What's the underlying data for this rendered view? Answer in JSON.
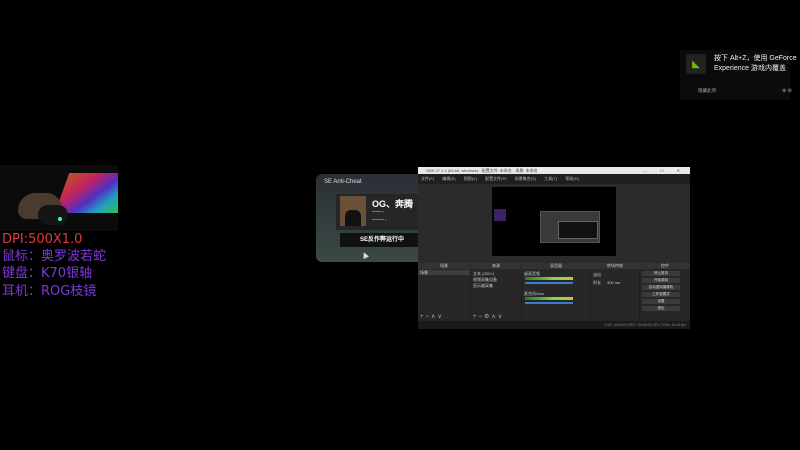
{
  "overlay": {
    "dpi": "DPI:500X1.0",
    "mouse": "鼠标：奥罗波若蛇",
    "keyboard": "键盘：K70银轴",
    "headset": "耳机：ROG枝镜"
  },
  "notification": {
    "line1": "按下 Alt+Z，使用 GeForce",
    "line2": "Experience 游戏内覆盖",
    "footer_left": "隐藏此项",
    "footer_right": "⊕ ⚙"
  },
  "se_window": {
    "title": "SE Anti-Cheat",
    "player_name": "OG、奔腾",
    "button": "SE反作弊运行中"
  },
  "obs": {
    "title": "OBS 27.1.3 (64-bit, windows) - 配置文件: 未命名 - 场景: 未命名",
    "menus": [
      "文件(F)",
      "编辑(E)",
      "视图(V)",
      "配置文件(P)",
      "场景集合(S)",
      "工具(T)",
      "帮助(H)"
    ],
    "docks": {
      "scenes": {
        "header": "场景",
        "items": [
          "场景"
        ]
      },
      "sources": {
        "header": "来源",
        "items": [
          "文本 (GDI+)",
          "视频采集设备",
          "显示器采集"
        ]
      },
      "mixer": {
        "header": "混音器",
        "channels": [
          "桌面音频",
          "麦克风/Aux"
        ]
      },
      "transitions": {
        "header": "转场特效",
        "type": "淡出",
        "duration_label": "时长",
        "duration": "300 ms"
      },
      "controls": {
        "header": "控件",
        "buttons": [
          "停止推流",
          "开始录制",
          "启动虚拟摄像机",
          "工作室模式",
          "设置",
          "退出"
        ]
      }
    },
    "status": "LIVE: 00:00:00   REC: 00:00:00   CPU: 3.5%, 60.00 fps"
  },
  "colors": {
    "dpi": "#e03a3a",
    "overlay_text": "#7a3ad8",
    "obs_bg": "#1f1f1f"
  }
}
